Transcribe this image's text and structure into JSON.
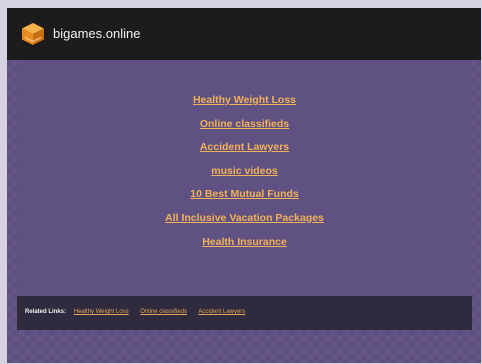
{
  "header": {
    "site_name": "bigames.online",
    "logo_icon": "orange-cube-icon"
  },
  "main": {
    "links": [
      "Healthy Weight Loss",
      "Online classifieds",
      "Accident Lawyers",
      "music videos",
      "10 Best Mutual Funds",
      "All Inclusive Vacation Packages",
      "Health Insurance"
    ]
  },
  "footer": {
    "label": "Related Links:",
    "links": [
      "Healthy Weight Loss",
      "Online classifieds",
      "Accident Lawyers"
    ]
  },
  "colors": {
    "header_bg": "#1c1c1c",
    "page_bg": "#5e4f80",
    "link": "#f1b25a",
    "footer_bg": "#2f2a3d"
  }
}
